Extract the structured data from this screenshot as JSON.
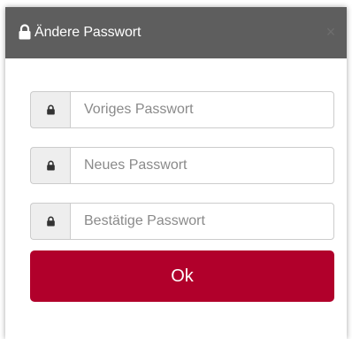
{
  "dialog": {
    "title": "Ändere Passwort",
    "close_label": "×",
    "colors": {
      "header_bg": "#5e5e5e",
      "button_bg": "#b1002b",
      "addon_bg": "#eeeeee",
      "border": "#cccccc"
    }
  },
  "fields": [
    {
      "icon": "lock-icon",
      "value": "",
      "placeholder": "Voriges Passwort"
    },
    {
      "icon": "lock-icon",
      "value": "",
      "placeholder": "Neues Passwort"
    },
    {
      "icon": "lock-icon",
      "value": "",
      "placeholder": "Bestätige Passwort"
    }
  ],
  "submit": {
    "label": "Ok"
  }
}
